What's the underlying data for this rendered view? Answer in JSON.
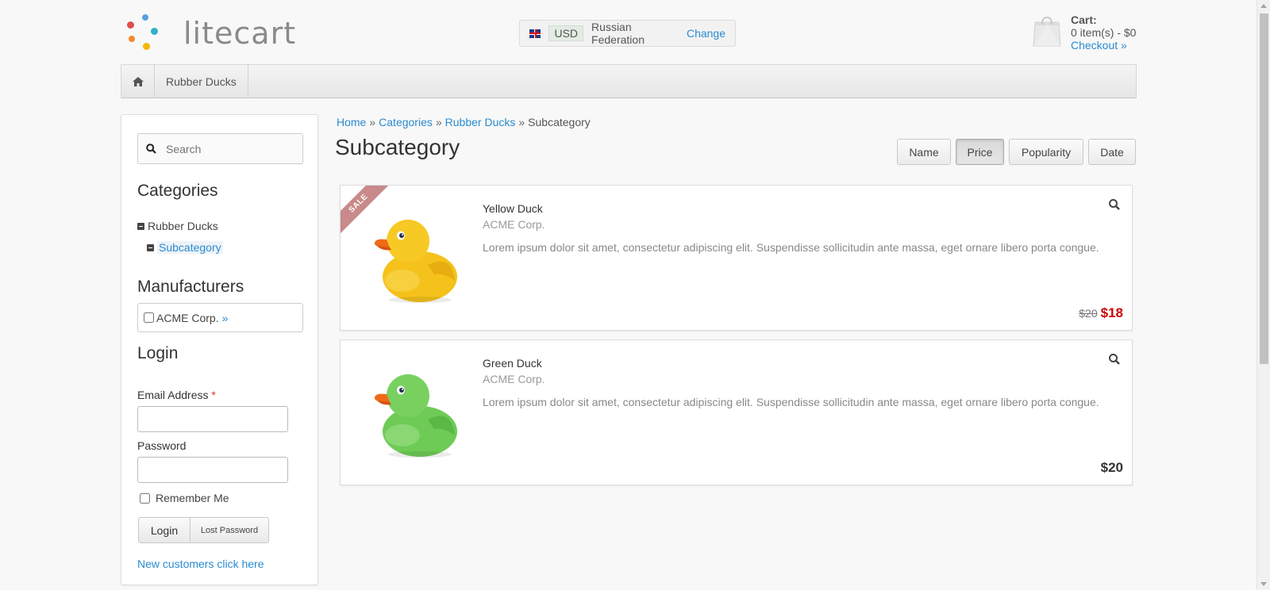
{
  "brand": {
    "name": "litecart"
  },
  "region": {
    "currency": "USD",
    "country": "Russian Federation",
    "change_label": "Change",
    "flag_icon": "uk-flag-icon"
  },
  "cart": {
    "title": "Cart:",
    "summary": "0 item(s) - $0",
    "checkout_label": "Checkout »",
    "icon": "shopping-bag-icon"
  },
  "nav": {
    "home_icon": "home-icon",
    "items": [
      {
        "label": "Rubber Ducks"
      }
    ]
  },
  "search": {
    "placeholder": "Search",
    "icon": "search-icon"
  },
  "sidebar": {
    "categories_title": "Categories",
    "categories": [
      {
        "label": "Rubber Ducks",
        "active": false
      },
      {
        "label": "Subcategory",
        "active": true
      }
    ],
    "manufacturers_title": "Manufacturers",
    "manufacturers": [
      {
        "label": "ACME Corp.",
        "link": "»"
      }
    ],
    "login": {
      "title": "Login",
      "email_label": "Email Address",
      "required_mark": "*",
      "password_label": "Password",
      "remember_label": "Remember Me",
      "login_button": "Login",
      "lost_password_button": "Lost Password",
      "new_customers_link": "New customers click here"
    }
  },
  "breadcrumb": [
    {
      "label": "Home",
      "link": true
    },
    {
      "label": "Categories",
      "link": true
    },
    {
      "label": "Rubber Ducks",
      "link": true
    },
    {
      "label": "Subcategory",
      "link": false
    }
  ],
  "breadcrumb_separator": "»",
  "page_title": "Subcategory",
  "sort": {
    "options": [
      "Name",
      "Price",
      "Popularity",
      "Date"
    ],
    "selected": "Price"
  },
  "products": [
    {
      "name": "Yellow Duck",
      "manufacturer": "ACME Corp.",
      "description": "Lorem ipsum dolor sit amet, consectetur adipiscing elit. Suspendisse sollicitudin ante massa, eget ornare libero porta congue.",
      "old_price": "$20",
      "price": "$18",
      "sale_label": "SALE",
      "color": "#f5c21b"
    },
    {
      "name": "Green Duck",
      "manufacturer": "ACME Corp.",
      "description": "Lorem ipsum dolor sit amet, consectetur adipiscing elit. Suspendisse sollicitudin ante massa, eget ornare libero porta congue.",
      "price": "$20",
      "color": "#6ecb55"
    }
  ],
  "colors": {
    "link": "#2a8bcf",
    "sale_price": "#cc0000",
    "sale_ribbon": "#c88a8a"
  }
}
